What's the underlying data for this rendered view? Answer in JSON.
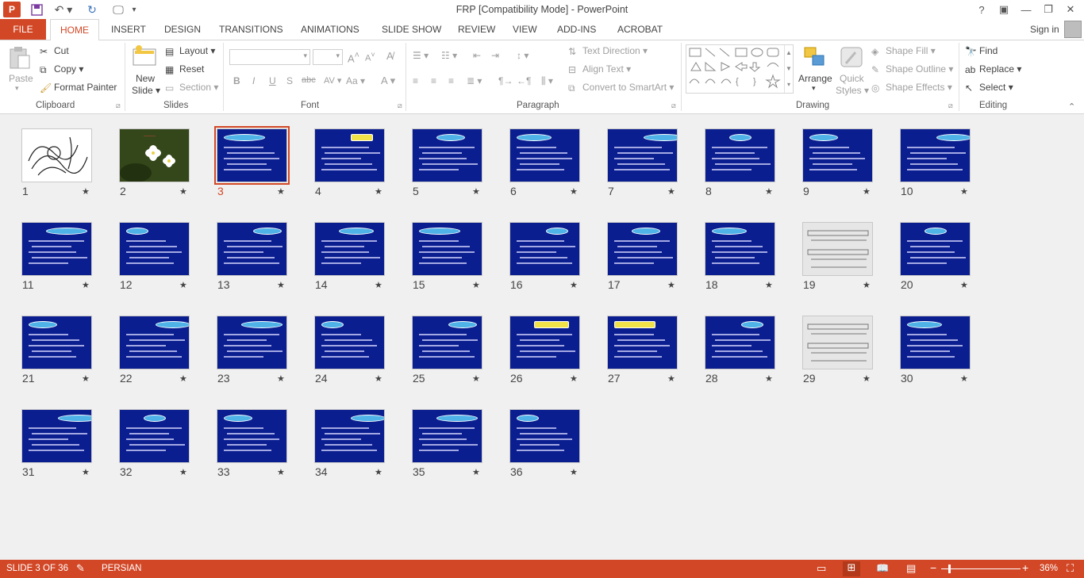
{
  "window": {
    "title": "FRP [Compatibility Mode] - PowerPoint",
    "help": "?",
    "controls": [
      "ribbon-display",
      "minimize",
      "restore",
      "close"
    ]
  },
  "tabs": {
    "file": "FILE",
    "home": "HOME",
    "items": [
      "INSERT",
      "DESIGN",
      "TRANSITIONS",
      "ANIMATIONS",
      "SLIDE SHOW",
      "REVIEW",
      "VIEW",
      "ADD-INS",
      "ACROBAT"
    ],
    "sign_in": "Sign in"
  },
  "ribbon": {
    "clipboard": {
      "label": "Clipboard",
      "paste": "Paste",
      "cut": "Cut",
      "copy": "Copy",
      "format_painter": "Format Painter"
    },
    "slides": {
      "label": "Slides",
      "new_slide_1": "New",
      "new_slide_2": "Slide",
      "layout": "Layout",
      "reset": "Reset",
      "section": "Section"
    },
    "font": {
      "label": "Font",
      "font_name": "",
      "font_size": ""
    },
    "paragraph": {
      "label": "Paragraph",
      "text_direction": "Text Direction",
      "align_text": "Align Text",
      "convert_smartart": "Convert to SmartArt"
    },
    "drawing": {
      "label": "Drawing",
      "arrange": "Arrange",
      "quick_styles_1": "Quick",
      "quick_styles_2": "Styles",
      "shape_fill": "Shape Fill",
      "shape_outline": "Shape Outline",
      "shape_effects": "Shape Effects"
    },
    "editing": {
      "label": "Editing",
      "find": "Find",
      "replace": "Replace",
      "select": "Select"
    }
  },
  "slides": [
    {
      "n": "1",
      "kind": "white"
    },
    {
      "n": "2",
      "kind": "flower"
    },
    {
      "n": "3",
      "kind": "blue",
      "selected": true
    },
    {
      "n": "4",
      "kind": "blue"
    },
    {
      "n": "5",
      "kind": "blue"
    },
    {
      "n": "6",
      "kind": "blue"
    },
    {
      "n": "7",
      "kind": "blue"
    },
    {
      "n": "8",
      "kind": "blue"
    },
    {
      "n": "9",
      "kind": "blue"
    },
    {
      "n": "10",
      "kind": "blue"
    },
    {
      "n": "11",
      "kind": "blue"
    },
    {
      "n": "12",
      "kind": "blue"
    },
    {
      "n": "13",
      "kind": "blue"
    },
    {
      "n": "14",
      "kind": "blue"
    },
    {
      "n": "15",
      "kind": "blue"
    },
    {
      "n": "16",
      "kind": "blue"
    },
    {
      "n": "17",
      "kind": "blue"
    },
    {
      "n": "18",
      "kind": "blue"
    },
    {
      "n": "19",
      "kind": "gray"
    },
    {
      "n": "20",
      "kind": "blue"
    },
    {
      "n": "21",
      "kind": "blue"
    },
    {
      "n": "22",
      "kind": "blue"
    },
    {
      "n": "23",
      "kind": "blue"
    },
    {
      "n": "24",
      "kind": "blue"
    },
    {
      "n": "25",
      "kind": "blue"
    },
    {
      "n": "26",
      "kind": "blue"
    },
    {
      "n": "27",
      "kind": "blue"
    },
    {
      "n": "28",
      "kind": "blue"
    },
    {
      "n": "29",
      "kind": "gray"
    },
    {
      "n": "30",
      "kind": "blue"
    },
    {
      "n": "31",
      "kind": "blue"
    },
    {
      "n": "32",
      "kind": "blue"
    },
    {
      "n": "33",
      "kind": "blue"
    },
    {
      "n": "34",
      "kind": "blue"
    },
    {
      "n": "35",
      "kind": "blue"
    },
    {
      "n": "36",
      "kind": "blue"
    }
  ],
  "status": {
    "slide_info": "SLIDE 3 OF 36",
    "language": "PERSIAN",
    "zoom": "36%",
    "zoom_fraction": 0.36
  },
  "colors": {
    "accent": "#d24726",
    "slide_blue": "#0b1e8f"
  }
}
